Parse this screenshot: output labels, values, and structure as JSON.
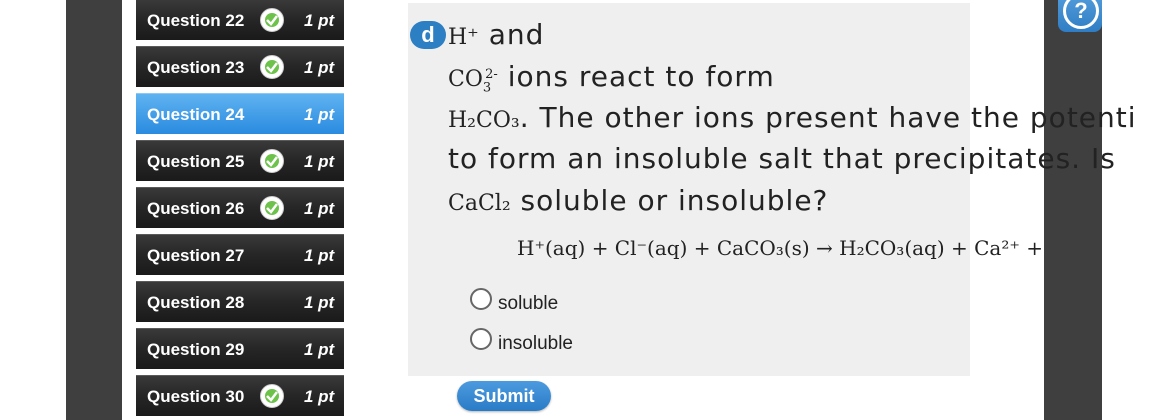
{
  "sidebar": {
    "items": [
      {
        "label": "Question 22",
        "points": "1 pt",
        "completed": true,
        "active": false
      },
      {
        "label": "Question 23",
        "points": "1 pt",
        "completed": true,
        "active": false
      },
      {
        "label": "Question 24",
        "points": "1 pt",
        "completed": false,
        "active": true
      },
      {
        "label": "Question 25",
        "points": "1 pt",
        "completed": true,
        "active": false
      },
      {
        "label": "Question 26",
        "points": "1 pt",
        "completed": true,
        "active": false
      },
      {
        "label": "Question 27",
        "points": "1 pt",
        "completed": false,
        "active": false
      },
      {
        "label": "Question 28",
        "points": "1 pt",
        "completed": false,
        "active": false
      },
      {
        "label": "Question 29",
        "points": "1 pt",
        "completed": false,
        "active": false
      },
      {
        "label": "Question 30",
        "points": "1 pt",
        "completed": true,
        "active": false
      }
    ]
  },
  "question": {
    "part_badge": "d",
    "line1_chem": "H⁺",
    "line1_text": " and",
    "line2_chem_base": "CO",
    "line2_chem_sub": "3",
    "line2_chem_sup": "2-",
    "line2_text": " ions react to form",
    "line3_chem": "H₂CO₃",
    "line3_text": ". The other ions present have the potenti",
    "line4_text": "to form an insoluble salt that precipitates. Is",
    "line5_chem": "CaCl₂",
    "line5_text": " soluble or insoluble?",
    "equation": "H⁺(aq) + Cl⁻(aq) + CaCO₃(s) → H₂CO₃(aq) + Ca²⁺ +"
  },
  "options": [
    {
      "label": "soluble",
      "selected": false
    },
    {
      "label": "insoluble",
      "selected": false
    }
  ],
  "submit_label": "Submit",
  "help": {
    "icon": "help-icon",
    "glyph": "?"
  },
  "colors": {
    "accent": "#2d7fc4",
    "active_item": "#2a8be0",
    "check_green": "#6cc24a",
    "sidebar_item": "#262626"
  }
}
